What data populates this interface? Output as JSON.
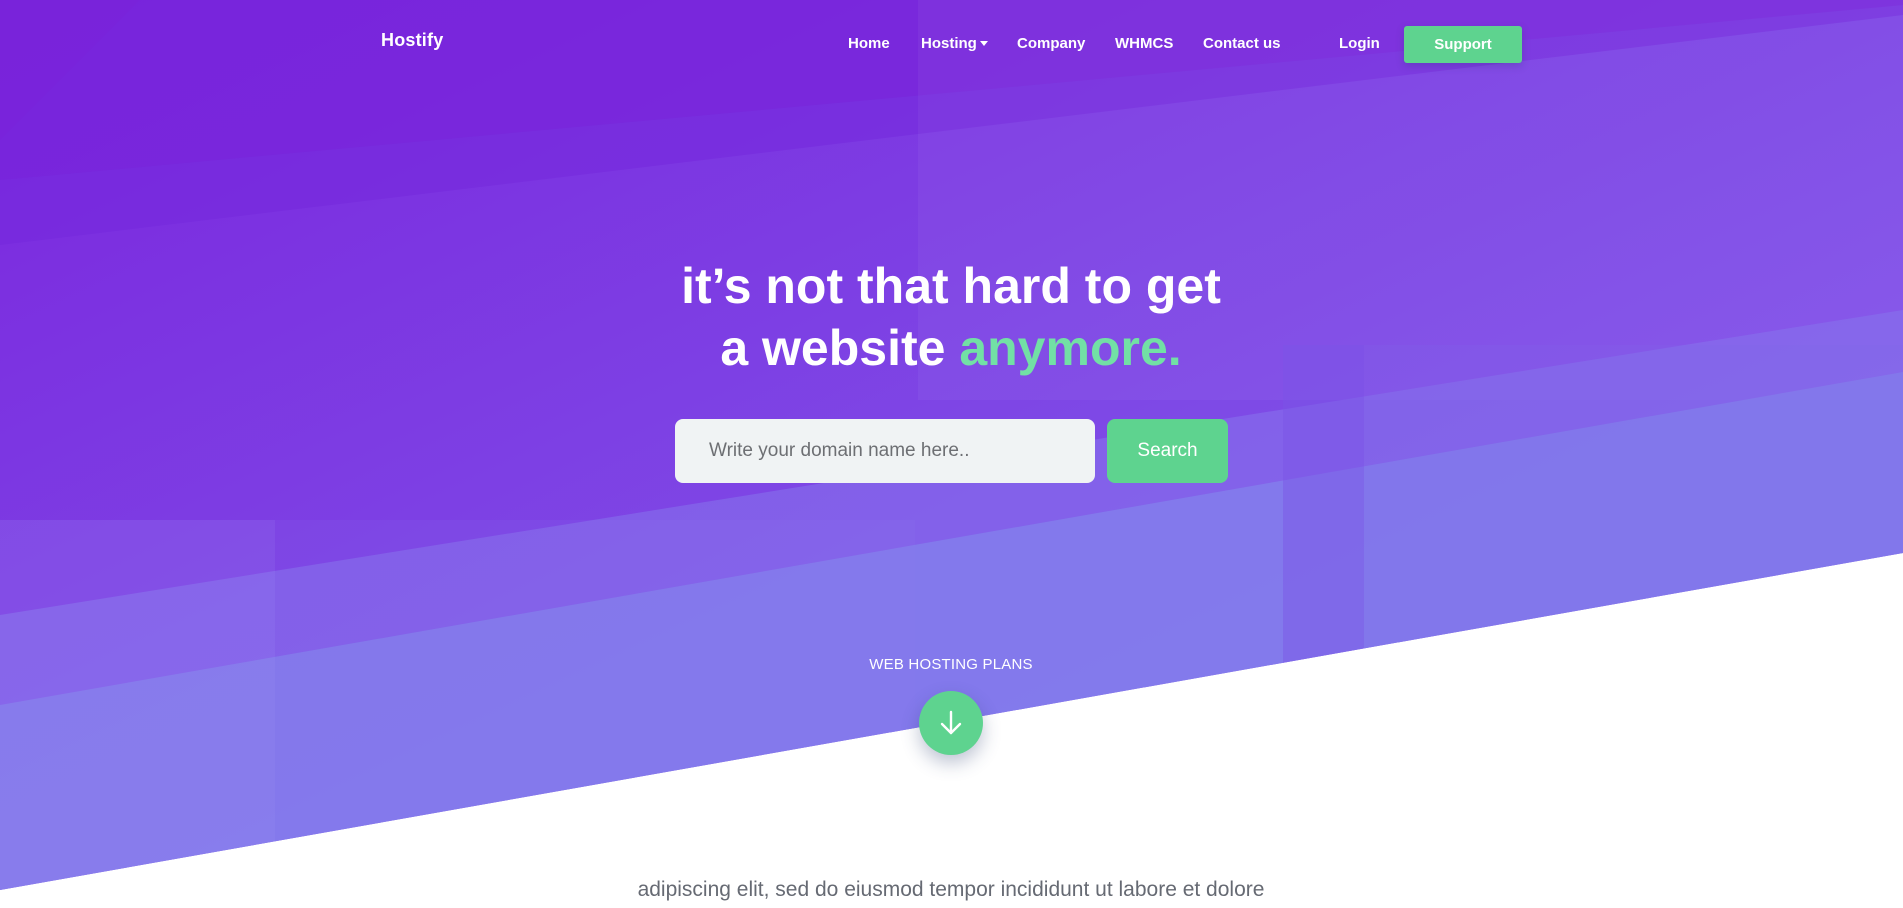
{
  "brand": {
    "name": "Hostify"
  },
  "nav": {
    "items": [
      {
        "label": "Home"
      },
      {
        "label": "Hosting",
        "has_dropdown": true
      },
      {
        "label": "Company"
      },
      {
        "label": "WHMCS"
      },
      {
        "label": "Contact us"
      }
    ],
    "login_label": "Login",
    "support_label": "Support"
  },
  "hero": {
    "headline_line1": "it’s not that hard to get",
    "headline_line2_prefix": "a website ",
    "headline_line2_accent": "anymore."
  },
  "domain_search": {
    "placeholder": "Write your domain name here..",
    "value": "",
    "button_label": "Search"
  },
  "plans_section": {
    "label": "WEB HOSTING PLANS",
    "scroll_icon": "arrow-down-icon"
  },
  "body_excerpt": "adipiscing elit, sed do eiusmod tempor incididunt ut labore et dolore",
  "colors": {
    "hero_gradient_start": "#7b25de",
    "hero_gradient_end": "#8a5ff0",
    "accent_green": "#5ed38f",
    "headline_accent": "#72e0a5",
    "input_background": "#f0f3f4",
    "body_text": "#666a73"
  }
}
